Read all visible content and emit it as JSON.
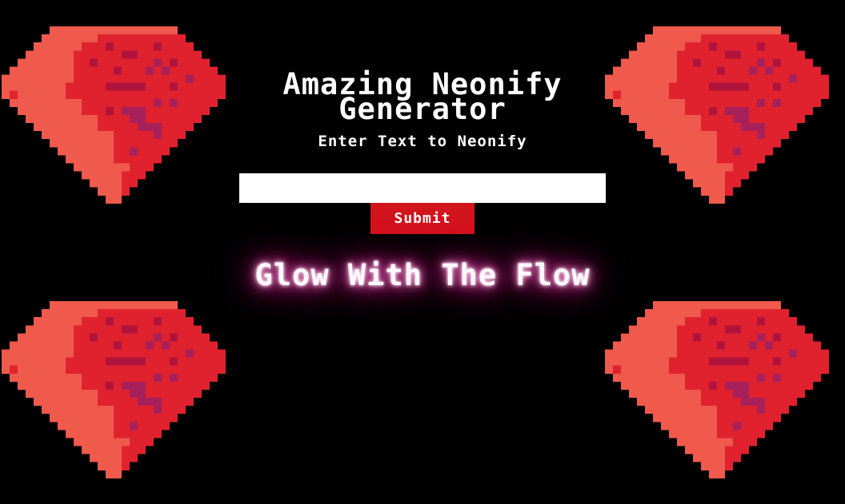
{
  "header": {
    "title": "Amazing Neonify Generator",
    "subtitle": "Enter Text to Neonify"
  },
  "form": {
    "input_value": "",
    "input_placeholder": "",
    "submit_label": "Submit"
  },
  "output": {
    "neon_text": "Glow With The Flow"
  },
  "colors": {
    "background": "#000000",
    "button": "#d2141c",
    "neon_glow": "#ff2aa8",
    "gem_light": "#ef5a4c",
    "gem_mid": "#e0222e",
    "gem_dark": "#b0143c",
    "gem_accent": "#a8205a"
  },
  "decorations": {
    "gem_icon": "pixel-ruby-gem"
  }
}
